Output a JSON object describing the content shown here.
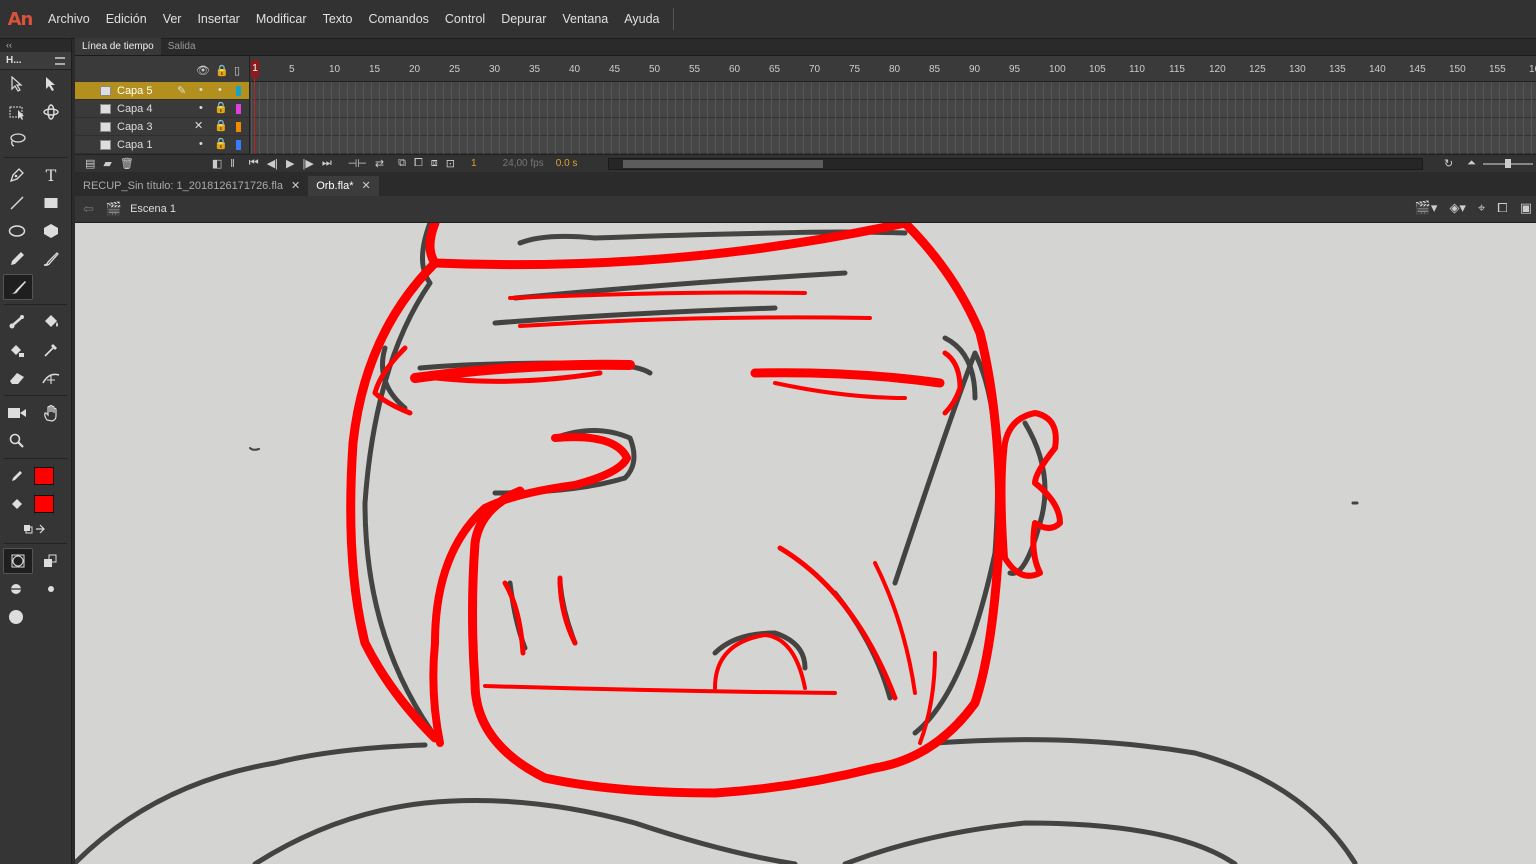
{
  "app": {
    "logo": "An"
  },
  "menu": [
    "Archivo",
    "Edición",
    "Ver",
    "Insertar",
    "Modificar",
    "Texto",
    "Comandos",
    "Control",
    "Depurar",
    "Ventana",
    "Ayuda"
  ],
  "toolbar": {
    "head": "‹‹",
    "tab_label": "H..."
  },
  "timeline": {
    "tabs": [
      "Línea de tiempo",
      "Salida"
    ],
    "layers": [
      {
        "name": "Capa 5",
        "color": "#17a2c8",
        "active": true
      },
      {
        "name": "Capa 4",
        "color": "#e040e0",
        "active": false
      },
      {
        "name": "Capa 3",
        "color": "#f08a00",
        "active": false
      },
      {
        "name": "Capa 1",
        "color": "#3a7bff",
        "active": false
      }
    ],
    "ruler": [
      "5",
      "10",
      "15",
      "20",
      "25",
      "30",
      "35",
      "40",
      "45",
      "50",
      "55",
      "60",
      "65",
      "70",
      "75",
      "80",
      "85",
      "90",
      "95",
      "100",
      "105",
      "110",
      "115",
      "120",
      "125",
      "130",
      "135",
      "140",
      "145",
      "150",
      "155",
      "16"
    ],
    "playhead_frame": "1",
    "current_frame": "1",
    "fps": "24,00 fps",
    "time": "0.0 s"
  },
  "documents": [
    {
      "name": "RECUP_Sin título: 1_2018126171726.fla",
      "active": false
    },
    {
      "name": "Orb.fla*",
      "active": true
    }
  ],
  "editbar": {
    "scene": "Escena 1"
  },
  "colors": {
    "stroke": "#ff0000",
    "fill": "#ff0000",
    "accent_layer": "#b38f1e"
  }
}
